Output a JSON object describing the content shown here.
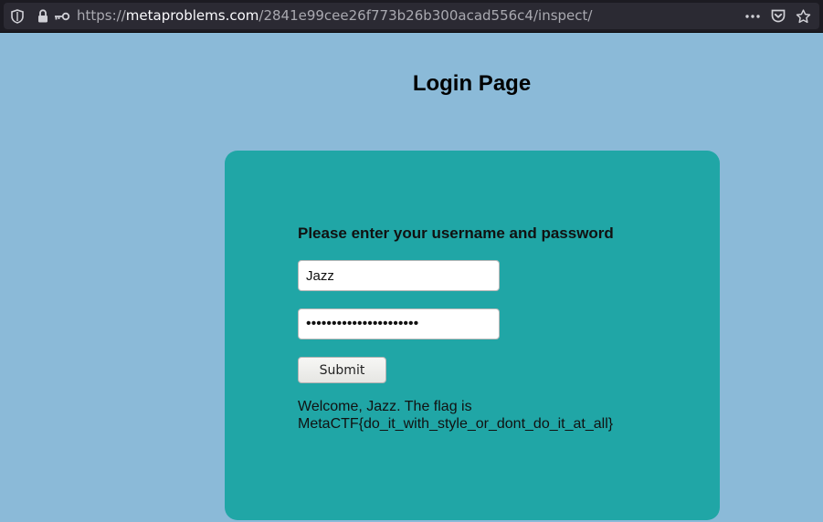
{
  "browser": {
    "url_scheme": "https://",
    "url_host": "metaproblems.com",
    "url_path": "/2841e99cee26f773b26b300acad556c4/inspect/"
  },
  "page": {
    "title": "Login Page",
    "form": {
      "prompt": "Please enter your username and password",
      "username_value": "Jazz",
      "password_value": "••••••••••••••••••••••",
      "submit_label": "Submit"
    },
    "result": {
      "line1": "Welcome, Jazz. The flag is",
      "line2": "MetaCTF{do_it_with_style_or_dont_do_it_at_all}"
    }
  },
  "colors": {
    "page_background": "#8bbad8",
    "card_background": "#20a6a6",
    "toolbar_background": "#1c1b22"
  },
  "icons": [
    "shield-icon",
    "lock-icon",
    "key-icon",
    "more-icon",
    "pocket-icon",
    "bookmark-star-icon"
  ]
}
